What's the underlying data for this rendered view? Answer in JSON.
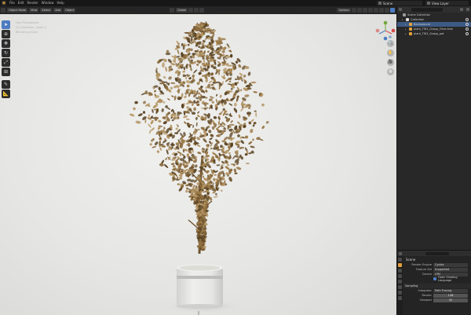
{
  "topbar": {
    "menus": [
      "File",
      "Edit",
      "Render",
      "Window",
      "Help"
    ],
    "scene_label": "Scene",
    "view_layer_label": "View Layer"
  },
  "viewport_header": {
    "mode": "Object Mode",
    "menu_view": "View",
    "menu_select": "Select",
    "menu_add": "Add",
    "menu_object": "Object",
    "transform": "Global",
    "options": "Options"
  },
  "viewport_info": {
    "line1": "User Perspective",
    "line2": "(1) Collection | plant_1",
    "line3": "Rendering Done"
  },
  "tools": [
    {
      "icon": "cursor-select-icon",
      "glyph": "➤",
      "active": true
    },
    {
      "icon": "3d-cursor-icon",
      "glyph": "⊕",
      "active": false
    },
    {
      "icon": "move-icon",
      "glyph": "✥",
      "active": false
    },
    {
      "icon": "rotate-icon",
      "glyph": "↻",
      "active": false
    },
    {
      "icon": "scale-icon",
      "glyph": "⤢",
      "active": false
    },
    {
      "icon": "transform-icon",
      "glyph": "⊞",
      "active": false
    },
    {
      "icon": "annotate-icon",
      "glyph": "✎",
      "active": false
    },
    {
      "icon": "measure-icon",
      "glyph": "📐",
      "active": false
    }
  ],
  "nav_buttons": [
    {
      "icon": "zoom-icon",
      "glyph": "🔍"
    },
    {
      "icon": "pan-hand-icon",
      "glyph": "✋"
    },
    {
      "icon": "camera-view-icon",
      "glyph": "🎥"
    },
    {
      "icon": "ortho-grid-icon",
      "glyph": "▦"
    }
  ],
  "outliner": {
    "title": "Scene Collection",
    "rows": [
      {
        "label": "Scene Collection",
        "type": "scene",
        "icon_color": "#9a9a9a"
      },
      {
        "label": "Collection",
        "type": "collection",
        "icon_color": "#dcdcdc"
      },
      {
        "label": "Background",
        "type": "object-selected",
        "icon_color": "#e3a13b"
      },
      {
        "label": "plant_TW1_Grapp_Olive.tree",
        "type": "object",
        "icon_color": "#e3a13b"
      },
      {
        "label": "plant_TW1_Grapp_pot",
        "type": "object",
        "icon_color": "#e3a13b"
      }
    ]
  },
  "properties": {
    "section_title": "Scene",
    "render_engine_label": "Render Engine",
    "render_engine_value": "Cycles",
    "feature_set_label": "Feature Set",
    "feature_set_value": "Supported",
    "device_label": "Device",
    "device_value": "CPU",
    "osl_label": "Open Shading Language",
    "sampling_label": "Sampling",
    "integrator_label": "Integrator",
    "integrator_value": "Path Tracing",
    "render_label": "Render",
    "render_value": "128",
    "viewport_label": "Viewport",
    "viewport_value": "32"
  },
  "colors": {
    "accent_blue": "#4d7bc1",
    "accent_orange": "#e3a13b",
    "foliage_dark": "#5a4424",
    "foliage_mid": "#8a6a3c",
    "foliage_light": "#b39462",
    "pot": "#e4e4e2"
  }
}
